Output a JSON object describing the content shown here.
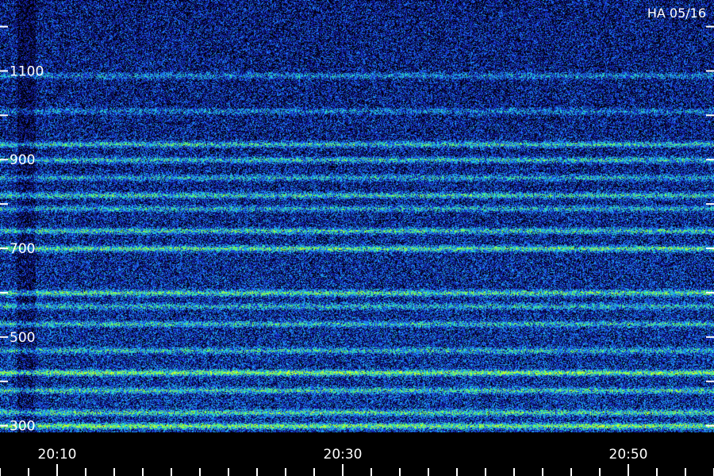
{
  "chart_data": {
    "type": "heatmap",
    "title": "",
    "label": "HA 05/16",
    "xlabel": "",
    "ylabel": "",
    "x_ticks": [
      "20:10",
      "20:30",
      "20:50"
    ],
    "x_tick_minutes": [
      10,
      30,
      50
    ],
    "x_range_minutes": [
      6,
      56
    ],
    "x_minor_step_minutes": 2,
    "y_ticks": [
      300,
      500,
      700,
      900,
      1100
    ],
    "y_minor_ticks": [
      400,
      600,
      800,
      1000,
      1200
    ],
    "y_range": [
      285,
      1260
    ],
    "bands": [
      {
        "freq": 1090,
        "intensity": 0.35
      },
      {
        "freq": 1010,
        "intensity": 0.3
      },
      {
        "freq": 935,
        "intensity": 0.6
      },
      {
        "freq": 900,
        "intensity": 0.55
      },
      {
        "freq": 860,
        "intensity": 0.45
      },
      {
        "freq": 820,
        "intensity": 0.6
      },
      {
        "freq": 790,
        "intensity": 0.45
      },
      {
        "freq": 740,
        "intensity": 0.6
      },
      {
        "freq": 700,
        "intensity": 0.75
      },
      {
        "freq": 600,
        "intensity": 0.7
      },
      {
        "freq": 570,
        "intensity": 0.45
      },
      {
        "freq": 530,
        "intensity": 0.5
      },
      {
        "freq": 470,
        "intensity": 0.45
      },
      {
        "freq": 420,
        "intensity": 0.85
      },
      {
        "freq": 380,
        "intensity": 0.55
      },
      {
        "freq": 330,
        "intensity": 0.6
      },
      {
        "freq": 300,
        "intensity": 0.8
      }
    ],
    "colormap": [
      "#000000",
      "#0a0a5c",
      "#1a2ad8",
      "#1e90ff",
      "#20e0d0",
      "#7dff3c",
      "#e6ff20"
    ],
    "grid": false
  }
}
